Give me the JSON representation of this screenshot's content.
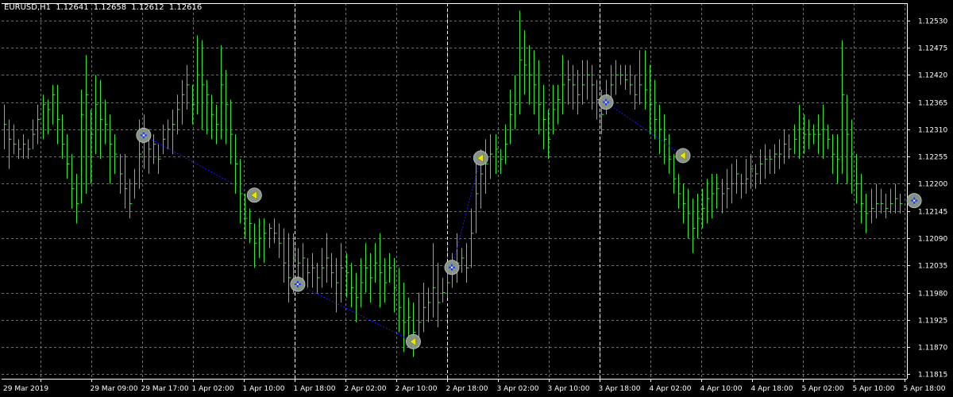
{
  "window": {
    "symbol": "EURUSD,H1",
    "open": "1.12641",
    "high": "1.12658",
    "low": "1.12612",
    "close": "1.12616"
  },
  "colors": {
    "background": "#000000",
    "grid": "#6e6e6e",
    "bar": "#35e835",
    "axis": "#ffffff",
    "text": "#ffffff",
    "line": "#1a1aff",
    "marker_fill": "#8d9a8d",
    "marker_arrow": "#e8e800",
    "marker_cross": "#1a3cff"
  },
  "chart_data": {
    "type": "ohlc",
    "y_ticks": [
      "1.12530",
      "1.12475",
      "1.12420",
      "1.12365",
      "1.12310",
      "1.12255",
      "1.12200",
      "1.12145",
      "1.12090",
      "1.12035",
      "1.11980",
      "1.11925",
      "1.11870",
      "1.11815"
    ],
    "x_ticks": [
      "29 Mar 2019",
      "29 Mar 09:00",
      "29 Mar 17:00",
      "1 Apr 02:00",
      "1 Apr 10:00",
      "1 Apr 18:00",
      "2 Apr 02:00",
      "2 Apr 10:00",
      "2 Apr 18:00",
      "3 Apr 02:00",
      "3 Apr 10:00",
      "3 Apr 18:00",
      "4 Apr 02:00",
      "4 Apr 10:00",
      "4 Apr 18:00",
      "5 Apr 02:00",
      "5 Apr 10:00",
      "5 Apr 18:00"
    ],
    "ylim": [
      1.11806,
      1.12565
    ],
    "bars": [
      [
        1.1227,
        1.1236,
        1.1232
      ],
      [
        1.1223,
        1.1233,
        1.1229
      ],
      [
        1.1226,
        1.1232,
        1.1228
      ],
      [
        1.1225,
        1.1229,
        1.1227
      ],
      [
        1.1225,
        1.123,
        1.1228
      ],
      [
        1.1225,
        1.1229,
        1.1227
      ],
      [
        1.1227,
        1.1233,
        1.123
      ],
      [
        1.1228,
        1.1236,
        1.1233
      ],
      [
        1.1229,
        1.1238,
        1.1236
      ],
      [
        1.123,
        1.1237,
        1.1235
      ],
      [
        1.1232,
        1.124,
        1.1238
      ],
      [
        1.1228,
        1.124,
        1.1233
      ],
      [
        1.1225,
        1.1234,
        1.1228
      ],
      [
        1.1221,
        1.123,
        1.1224
      ],
      [
        1.1215,
        1.1226,
        1.1219
      ],
      [
        1.1212,
        1.1222,
        1.1216
      ],
      [
        1.1216,
        1.1239,
        1.1234
      ],
      [
        1.1218,
        1.1246,
        1.1238
      ],
      [
        1.122,
        1.1235,
        1.123
      ],
      [
        1.1226,
        1.1242,
        1.1236
      ],
      [
        1.1225,
        1.1241,
        1.1233
      ],
      [
        1.1228,
        1.1237,
        1.1232
      ],
      [
        1.122,
        1.1234,
        1.1228
      ],
      [
        1.1222,
        1.123,
        1.1226
      ],
      [
        1.1218,
        1.1226,
        1.1222
      ],
      [
        1.1215,
        1.1226,
        1.1219
      ],
      [
        1.1213,
        1.1221,
        1.1216
      ],
      [
        1.1217,
        1.1223,
        1.122
      ],
      [
        1.1219,
        1.1233,
        1.1226
      ],
      [
        1.1223,
        1.1234,
        1.123
      ],
      [
        1.1222,
        1.1231,
        1.1227
      ],
      [
        1.1224,
        1.123,
        1.1228
      ],
      [
        1.1222,
        1.1228,
        1.1225
      ],
      [
        1.1226,
        1.1232,
        1.1229
      ],
      [
        1.1227,
        1.1233,
        1.1231
      ],
      [
        1.1226,
        1.1235,
        1.1232
      ],
      [
        1.123,
        1.1238,
        1.1235
      ],
      [
        1.1232,
        1.1241,
        1.1238
      ],
      [
        1.1235,
        1.1244,
        1.124
      ],
      [
        1.1232,
        1.124,
        1.1236
      ],
      [
        1.1234,
        1.125,
        1.1242
      ],
      [
        1.1231,
        1.1249,
        1.124
      ],
      [
        1.123,
        1.1241,
        1.1238
      ],
      [
        1.1229,
        1.1238,
        1.1234
      ],
      [
        1.1228,
        1.1236,
        1.1232
      ],
      [
        1.1229,
        1.1248,
        1.124
      ],
      [
        1.1228,
        1.1243,
        1.1236
      ],
      [
        1.1224,
        1.1237,
        1.123
      ],
      [
        1.1218,
        1.123,
        1.1224
      ],
      [
        1.1212,
        1.1225,
        1.1218
      ],
      [
        1.1209,
        1.1218,
        1.1213
      ],
      [
        1.1208,
        1.1215,
        1.1212
      ],
      [
        1.1203,
        1.1212,
        1.1208
      ],
      [
        1.1205,
        1.1213,
        1.1209
      ],
      [
        1.1204,
        1.1213,
        1.121
      ],
      [
        1.1207,
        1.1212,
        1.1211
      ],
      [
        1.1208,
        1.1213,
        1.121
      ],
      [
        1.1205,
        1.1212,
        1.1208
      ],
      [
        1.12,
        1.1211,
        1.1204
      ],
      [
        1.1196,
        1.121,
        1.1201
      ],
      [
        1.1198,
        1.121,
        1.1205
      ],
      [
        1.12,
        1.1207,
        1.1204
      ],
      [
        1.12,
        1.1208,
        1.1205
      ],
      [
        1.1199,
        1.1205,
        1.1202
      ],
      [
        1.1199,
        1.1206,
        1.1203
      ],
      [
        1.1198,
        1.1204,
        1.1201
      ],
      [
        1.1199,
        1.1207,
        1.1203
      ],
      [
        1.12,
        1.121,
        1.1205
      ],
      [
        1.1199,
        1.1206,
        1.1202
      ],
      [
        1.1194,
        1.1205,
        1.12
      ],
      [
        1.1196,
        1.1208,
        1.1203
      ],
      [
        1.1197,
        1.1206,
        1.1202
      ],
      [
        1.1195,
        1.1204,
        1.1199
      ],
      [
        1.1192,
        1.1202,
        1.1197
      ],
      [
        1.1195,
        1.1205,
        1.12
      ],
      [
        1.1198,
        1.1208,
        1.1203
      ],
      [
        1.1196,
        1.1206,
        1.1201
      ],
      [
        1.12,
        1.1208,
        1.1204
      ],
      [
        1.1195,
        1.121,
        1.1202
      ],
      [
        1.1196,
        1.1205,
        1.12
      ],
      [
        1.12,
        1.1206,
        1.1203
      ],
      [
        1.1194,
        1.1205,
        1.1199
      ],
      [
        1.119,
        1.1203,
        1.1195
      ],
      [
        1.1186,
        1.12,
        1.1192
      ],
      [
        1.1189,
        1.1197,
        1.1193
      ],
      [
        1.1185,
        1.1196,
        1.119
      ],
      [
        1.1187,
        1.1198,
        1.1192
      ],
      [
        1.119,
        1.12,
        1.1195
      ],
      [
        1.1192,
        1.1199,
        1.1196
      ],
      [
        1.1193,
        1.1208,
        1.1199
      ],
      [
        1.1191,
        1.1204,
        1.1196
      ],
      [
        1.1196,
        1.1201,
        1.1198
      ],
      [
        1.1197,
        1.1203,
        1.12
      ],
      [
        1.1199,
        1.1206,
        1.1202
      ],
      [
        1.12,
        1.121,
        1.1204
      ],
      [
        1.1202,
        1.1207,
        1.1205
      ],
      [
        1.12,
        1.1208,
        1.1203
      ],
      [
        1.1203,
        1.1215,
        1.121
      ],
      [
        1.121,
        1.1226,
        1.1218
      ],
      [
        1.1215,
        1.1227,
        1.1222
      ],
      [
        1.1218,
        1.1229,
        1.1224
      ],
      [
        1.1221,
        1.123,
        1.1226
      ],
      [
        1.1222,
        1.123,
        1.1227
      ],
      [
        1.1222,
        1.1227,
        1.1225
      ],
      [
        1.1224,
        1.1232,
        1.1228
      ],
      [
        1.1228,
        1.1239,
        1.1234
      ],
      [
        1.1231,
        1.1242,
        1.1236
      ],
      [
        1.1234,
        1.1255,
        1.1245
      ],
      [
        1.1238,
        1.1251,
        1.1244
      ],
      [
        1.1236,
        1.1248,
        1.1242
      ],
      [
        1.1234,
        1.1247,
        1.124
      ],
      [
        1.123,
        1.1245,
        1.1236
      ],
      [
        1.1227,
        1.124,
        1.1233
      ],
      [
        1.1225,
        1.1235,
        1.1229
      ],
      [
        1.123,
        1.124,
        1.1235
      ],
      [
        1.1232,
        1.124,
        1.1237
      ],
      [
        1.1234,
        1.1246,
        1.124
      ],
      [
        1.1236,
        1.1245,
        1.1241
      ],
      [
        1.1235,
        1.1244,
        1.124
      ],
      [
        1.1234,
        1.1243,
        1.1238
      ],
      [
        1.1236,
        1.1245,
        1.124
      ],
      [
        1.1237,
        1.1245,
        1.1242
      ],
      [
        1.1235,
        1.1244,
        1.124
      ],
      [
        1.1233,
        1.1241,
        1.1237
      ],
      [
        1.123,
        1.1239,
        1.1234
      ],
      [
        1.1234,
        1.1241,
        1.1238
      ],
      [
        1.1237,
        1.1244,
        1.124
      ],
      [
        1.1238,
        1.1245,
        1.1242
      ],
      [
        1.124,
        1.1244,
        1.1242
      ],
      [
        1.1239,
        1.1244,
        1.1241
      ],
      [
        1.1238,
        1.1244,
        1.124
      ],
      [
        1.1235,
        1.1242,
        1.1238
      ],
      [
        1.1236,
        1.1247,
        1.124
      ],
      [
        1.1235,
        1.1247,
        1.1239
      ],
      [
        1.123,
        1.1244,
        1.1236
      ],
      [
        1.1229,
        1.1241,
        1.1233
      ],
      [
        1.1226,
        1.1236,
        1.1231
      ],
      [
        1.1224,
        1.1234,
        1.1229
      ],
      [
        1.1222,
        1.123,
        1.1225
      ],
      [
        1.1218,
        1.1226,
        1.1221
      ],
      [
        1.1215,
        1.1222,
        1.1218
      ],
      [
        1.1212,
        1.122,
        1.1216
      ],
      [
        1.1209,
        1.1219,
        1.1214
      ],
      [
        1.1206,
        1.1217,
        1.1211
      ],
      [
        1.1209,
        1.1218,
        1.1213
      ],
      [
        1.1211,
        1.1219,
        1.1215
      ],
      [
        1.1212,
        1.1221,
        1.1217
      ],
      [
        1.1213,
        1.1222,
        1.1218
      ],
      [
        1.1215,
        1.1222,
        1.1219
      ],
      [
        1.1214,
        1.1221,
        1.1218
      ],
      [
        1.1215,
        1.1223,
        1.1219
      ],
      [
        1.1216,
        1.1224,
        1.122
      ],
      [
        1.1218,
        1.1225,
        1.1222
      ],
      [
        1.1217,
        1.1222,
        1.122
      ],
      [
        1.1218,
        1.1225,
        1.1221
      ],
      [
        1.1219,
        1.1226,
        1.1223
      ],
      [
        1.1219,
        1.1224,
        1.1222
      ],
      [
        1.122,
        1.1227,
        1.1224
      ],
      [
        1.1221,
        1.1228,
        1.1225
      ],
      [
        1.1222,
        1.1227,
        1.1225
      ],
      [
        1.1222,
        1.1228,
        1.1226
      ],
      [
        1.1223,
        1.1229,
        1.1226
      ],
      [
        1.1224,
        1.1231,
        1.1228
      ],
      [
        1.1225,
        1.123,
        1.1227
      ],
      [
        1.1226,
        1.1232,
        1.1229
      ],
      [
        1.1225,
        1.1236,
        1.1231
      ],
      [
        1.1226,
        1.1234,
        1.123
      ],
      [
        1.1227,
        1.1233,
        1.123
      ],
      [
        1.1228,
        1.1232,
        1.123
      ],
      [
        1.1226,
        1.1234,
        1.123
      ],
      [
        1.1225,
        1.1236,
        1.1231
      ],
      [
        1.1227,
        1.1232,
        1.1229
      ],
      [
        1.1222,
        1.123,
        1.1226
      ],
      [
        1.122,
        1.123,
        1.1225
      ],
      [
        1.1222,
        1.1249,
        1.1238
      ],
      [
        1.122,
        1.1238,
        1.123
      ],
      [
        1.1218,
        1.1233,
        1.1226
      ],
      [
        1.1216,
        1.1226,
        1.122
      ],
      [
        1.1212,
        1.1222,
        1.1216
      ],
      [
        1.121,
        1.1218,
        1.1214
      ],
      [
        1.1212,
        1.1219,
        1.1215
      ],
      [
        1.1213,
        1.122,
        1.1216
      ],
      [
        1.1214,
        1.1219,
        1.1216
      ],
      [
        1.1213,
        1.1218,
        1.1215
      ],
      [
        1.1214,
        1.1219,
        1.1216
      ],
      [
        1.1214,
        1.122,
        1.1217
      ],
      [
        1.1214,
        1.1218,
        1.1216
      ]
    ],
    "signals": [
      {
        "bar": 29,
        "price": 1.12298,
        "kind": "cross"
      },
      {
        "bar": 52,
        "price": 1.12177,
        "kind": "arrow"
      },
      {
        "bar": 61,
        "price": 1.11997,
        "kind": "cross"
      },
      {
        "bar": 85,
        "price": 1.11881,
        "kind": "arrow"
      },
      {
        "bar": 93,
        "price": 1.12031,
        "kind": "cross"
      },
      {
        "bar": 99,
        "price": 1.12252,
        "kind": "arrow"
      },
      {
        "bar": 125,
        "price": 1.12365,
        "kind": "cross"
      },
      {
        "bar": 141,
        "price": 1.12257,
        "kind": "arrow"
      },
      {
        "bar": 189,
        "price": 1.12166,
        "kind": "cross"
      }
    ],
    "connectors": [
      [
        0,
        1
      ],
      [
        2,
        3
      ],
      [
        4,
        5
      ],
      [
        6,
        7
      ]
    ]
  }
}
